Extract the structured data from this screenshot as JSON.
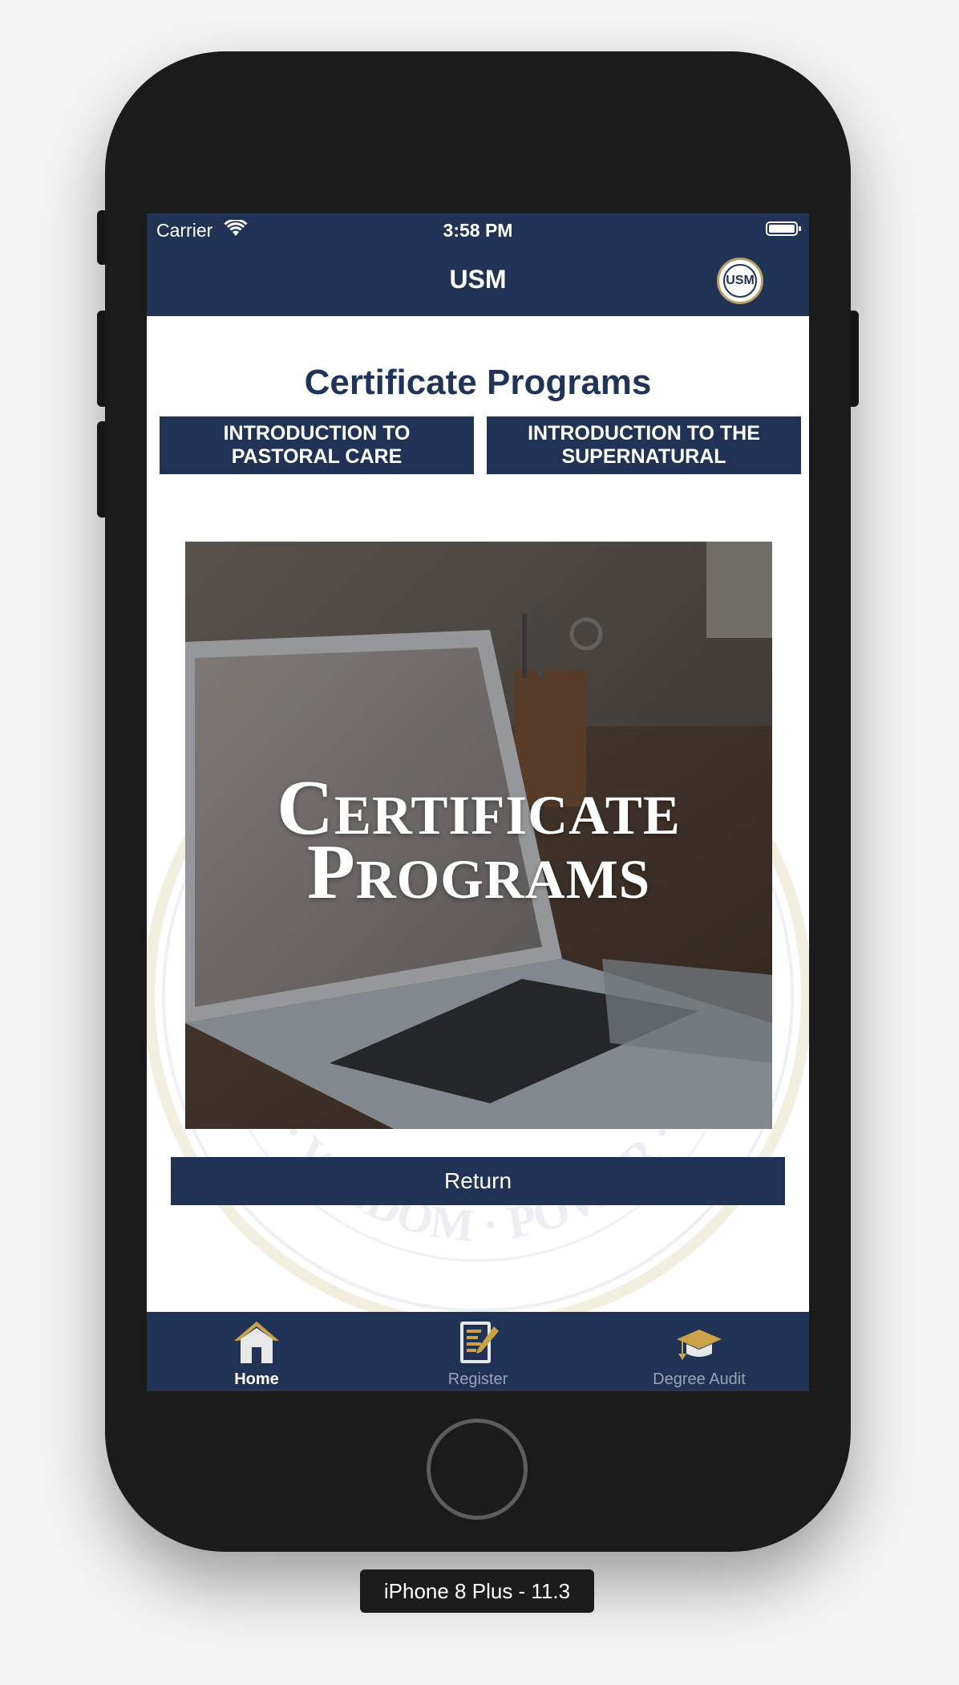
{
  "status_bar": {
    "carrier": "Carrier",
    "time": "3:58 PM"
  },
  "nav": {
    "title": "USM",
    "logo_text": "USM"
  },
  "page": {
    "title": "Certificate Programs",
    "programs": [
      {
        "label": "INTRODUCTION TO\nPASTORAL CARE"
      },
      {
        "label": "INTRODUCTION TO THE\nSUPERNATURAL"
      }
    ],
    "hero_text": "Certificate\nPrograms",
    "watermark_text": "· WISDOM · POWER ·",
    "return_label": "Return"
  },
  "tabs": [
    {
      "label": "Home",
      "icon": "home-icon",
      "active": true
    },
    {
      "label": "Register",
      "icon": "register-clipboard-icon",
      "active": false
    },
    {
      "label": "Degree Audit",
      "icon": "graduation-cap-icon",
      "active": false
    }
  ],
  "device_label": "iPhone 8 Plus - 11.3",
  "colors": {
    "primary": "#213355",
    "title_text": "#1f3457",
    "accent_gold": "#c9a24a",
    "white": "#ffffff"
  }
}
